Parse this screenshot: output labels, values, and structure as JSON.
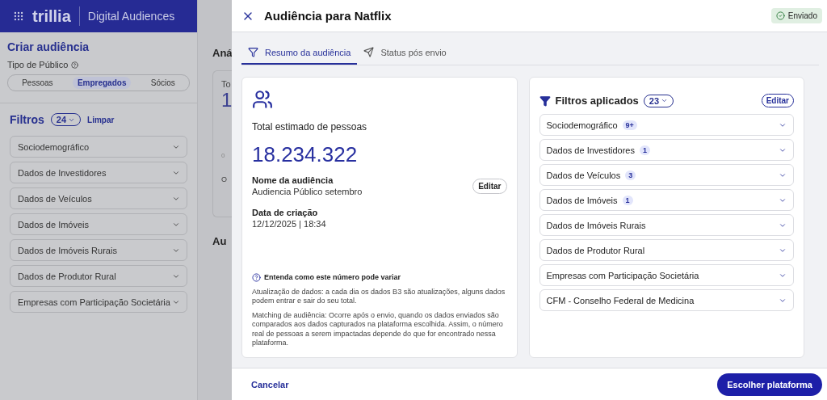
{
  "app_bar": {
    "logo": "trillia",
    "product": "Digital Audiences"
  },
  "sidebar": {
    "title": "Criar audiência",
    "audience_type_label": "Tipo de Público",
    "audience_types": [
      {
        "label": "Pessoas",
        "selected": false
      },
      {
        "label": "Empregados",
        "selected": true
      },
      {
        "label": "Sócios",
        "selected": false
      }
    ],
    "filters_label": "Filtros",
    "filters_count": "24",
    "clear": "Limpar",
    "filters": [
      {
        "label": "Sociodemográfico"
      },
      {
        "label": "Dados de Investidores"
      },
      {
        "label": "Dados de Veículos"
      },
      {
        "label": "Dados de Imóveis"
      },
      {
        "label": "Dados de Imóveis Rurais"
      },
      {
        "label": "Dados de Produtor Rural"
      },
      {
        "label": "Empresas com Participação Societária"
      }
    ]
  },
  "background_main": {
    "heading": "Aná",
    "card_label": "To",
    "card_value": "1",
    "axis_tick": "0",
    "card_note": "O",
    "section_heading": "Au"
  },
  "drawer": {
    "title": "Audiência para Natflix",
    "status": "Enviado",
    "tabs": [
      {
        "label": "Resumo da audiência",
        "selected": true
      },
      {
        "label": "Status pós envio",
        "selected": false
      }
    ],
    "summary": {
      "total_label": "Total estimado de pessoas",
      "total": "18.234.322",
      "name_label": "Nome da audiência",
      "name": "Audiencia Público setembro",
      "edit": "Editar",
      "date_label": "Data de criação",
      "date": "12/12/2025 | 18:34",
      "help_title": "Entenda como este número pode variar",
      "help_paragraphs": [
        "Atualização de dados: a cada dia os dados B3 são atualizações, alguns dados podem entrar e sair do seu total.",
        "Matching de audiência: Ocorre após o envio, quando os dados enviados são comparados aos dados capturados na plataforma escolhida. Assim, o número real de pessoas a serem impactadas depende do que for encontrado nessa plataforma."
      ]
    },
    "applied_filters": {
      "title": "Filtros aplicados",
      "count": "23",
      "edit": "Editar",
      "items": [
        {
          "label": "Sociodemográfico",
          "count": "9+"
        },
        {
          "label": "Dados de Investidores",
          "count": "1"
        },
        {
          "label": "Dados de Veículos",
          "count": "3"
        },
        {
          "label": "Dados de Imóveis",
          "count": "1"
        },
        {
          "label": "Dados de Imóveis Rurais"
        },
        {
          "label": "Dados de Produtor Rural"
        },
        {
          "label": "Empresas com Participação Societária"
        },
        {
          "label": "CFM - Conselho Federal de Medicina"
        }
      ]
    },
    "cancel": "Cancelar",
    "primary": "Escolher plataforma"
  }
}
